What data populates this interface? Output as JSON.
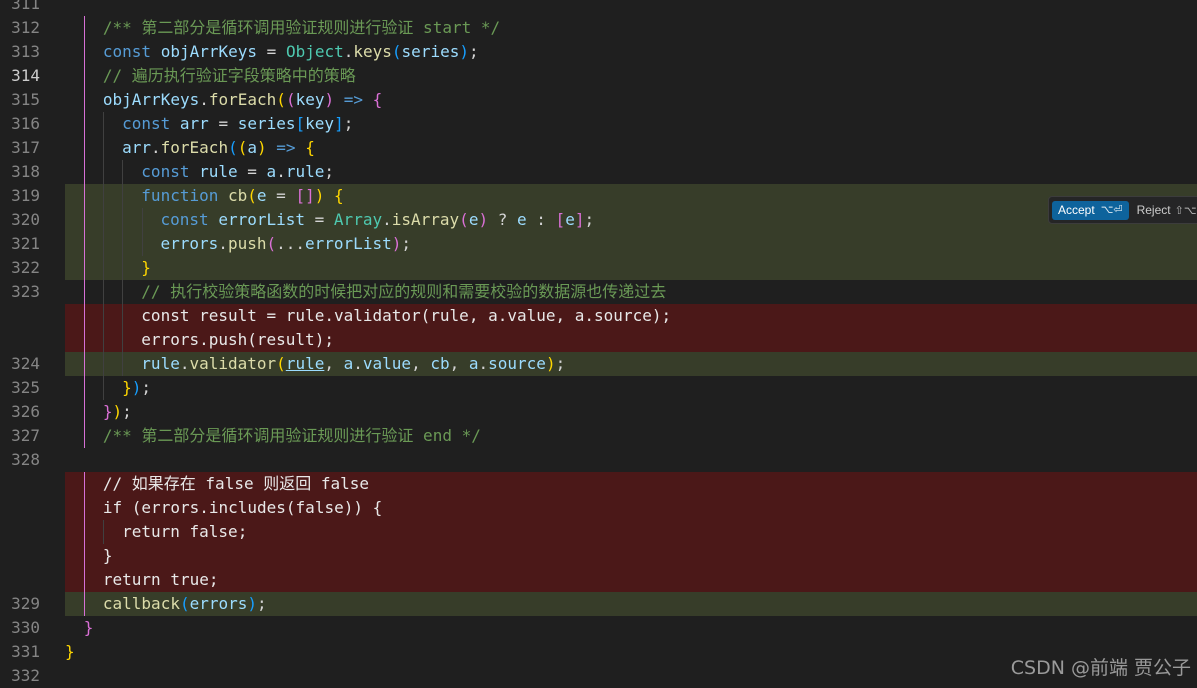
{
  "editor": {
    "rows": [
      {
        "ln": "311",
        "kind": "normal",
        "indent": 0,
        "tokens": []
      },
      {
        "ln": "312",
        "kind": "normal",
        "indent": 2,
        "tokens": [
          [
            "/** 第二部分是循环调用验证规则进行验证 start */",
            "cm"
          ]
        ]
      },
      {
        "ln": "313",
        "kind": "normal",
        "indent": 2,
        "tokens": [
          [
            "const",
            "kw"
          ],
          [
            " ",
            "pl"
          ],
          [
            "objArrKeys",
            "var"
          ],
          [
            " = ",
            "pl"
          ],
          [
            "Object",
            "cls"
          ],
          [
            ".",
            "pl"
          ],
          [
            "keys",
            "fn"
          ],
          [
            "(",
            "b3"
          ],
          [
            "series",
            "var"
          ],
          [
            ")",
            "b3"
          ],
          [
            ";",
            "pl"
          ]
        ]
      },
      {
        "ln": "314",
        "kind": "normal",
        "indent": 2,
        "active": true,
        "tokens": [
          [
            "// 遍历执行验证字段策略中的策略",
            "cm"
          ]
        ]
      },
      {
        "ln": "315",
        "kind": "normal",
        "indent": 2,
        "tokens": [
          [
            "objArrKeys",
            "var"
          ],
          [
            ".",
            "pl"
          ],
          [
            "forEach",
            "fn"
          ],
          [
            "(",
            "b1"
          ],
          [
            "(",
            "b2"
          ],
          [
            "key",
            "var"
          ],
          [
            ")",
            "b2"
          ],
          [
            " ",
            "pl"
          ],
          [
            "=>",
            "kw"
          ],
          [
            " ",
            "pl"
          ],
          [
            "{",
            "b2"
          ]
        ]
      },
      {
        "ln": "316",
        "kind": "normal",
        "indent": 3,
        "tokens": [
          [
            "const",
            "kw"
          ],
          [
            " ",
            "pl"
          ],
          [
            "arr",
            "var"
          ],
          [
            " = ",
            "pl"
          ],
          [
            "series",
            "var"
          ],
          [
            "[",
            "b3"
          ],
          [
            "key",
            "var"
          ],
          [
            "]",
            "b3"
          ],
          [
            ";",
            "pl"
          ]
        ]
      },
      {
        "ln": "317",
        "kind": "normal",
        "indent": 3,
        "tokens": [
          [
            "arr",
            "var"
          ],
          [
            ".",
            "pl"
          ],
          [
            "forEach",
            "fn"
          ],
          [
            "(",
            "b3"
          ],
          [
            "(",
            "b1"
          ],
          [
            "a",
            "var"
          ],
          [
            ")",
            "b1"
          ],
          [
            " ",
            "pl"
          ],
          [
            "=>",
            "kw"
          ],
          [
            " ",
            "pl"
          ],
          [
            "{",
            "b1"
          ]
        ]
      },
      {
        "ln": "318",
        "kind": "normal",
        "indent": 4,
        "tokens": [
          [
            "const",
            "kw"
          ],
          [
            " ",
            "pl"
          ],
          [
            "rule",
            "var"
          ],
          [
            " = ",
            "pl"
          ],
          [
            "a",
            "var"
          ],
          [
            ".",
            "pl"
          ],
          [
            "rule",
            "var"
          ],
          [
            ";",
            "pl"
          ]
        ]
      },
      {
        "ln": "319",
        "kind": "ins",
        "indent": 4,
        "tokens": [
          [
            "function",
            "kw"
          ],
          [
            " ",
            "pl"
          ],
          [
            "cb",
            "fn"
          ],
          [
            "(",
            "b1"
          ],
          [
            "e",
            "var"
          ],
          [
            " = ",
            "pl"
          ],
          [
            "[]",
            "b2"
          ],
          [
            ")",
            "b1"
          ],
          [
            " ",
            "pl"
          ],
          [
            "{",
            "b1"
          ]
        ]
      },
      {
        "ln": "320",
        "kind": "ins",
        "indent": 5,
        "tokens": [
          [
            "const",
            "kw"
          ],
          [
            " ",
            "pl"
          ],
          [
            "errorList",
            "var"
          ],
          [
            " = ",
            "pl"
          ],
          [
            "Array",
            "cls"
          ],
          [
            ".",
            "pl"
          ],
          [
            "isArray",
            "fn"
          ],
          [
            "(",
            "b2"
          ],
          [
            "e",
            "var"
          ],
          [
            ")",
            "b2"
          ],
          [
            " ? ",
            "pl"
          ],
          [
            "e",
            "var"
          ],
          [
            " : ",
            "pl"
          ],
          [
            "[",
            "b2"
          ],
          [
            "e",
            "var"
          ],
          [
            "]",
            "b2"
          ],
          [
            ";",
            "pl"
          ]
        ]
      },
      {
        "ln": "321",
        "kind": "ins",
        "indent": 5,
        "tokens": [
          [
            "errors",
            "var"
          ],
          [
            ".",
            "pl"
          ],
          [
            "push",
            "fn"
          ],
          [
            "(",
            "b2"
          ],
          [
            "...",
            "pl"
          ],
          [
            "errorList",
            "var"
          ],
          [
            ")",
            "b2"
          ],
          [
            ";",
            "pl"
          ]
        ]
      },
      {
        "ln": "322",
        "kind": "ins",
        "indent": 4,
        "tokens": [
          [
            "}",
            "b1"
          ]
        ]
      },
      {
        "ln": "323",
        "kind": "normal",
        "indent": 4,
        "tokens": [
          [
            "// 执行校验策略函数的时候把对应的规则和需要校验的数据源也传递过去",
            "cm"
          ]
        ]
      },
      {
        "ln": "",
        "kind": "del",
        "indent": 4,
        "tokens": [
          [
            "const result = rule.validator(rule, a.value, a.source);",
            "pl"
          ]
        ]
      },
      {
        "ln": "",
        "kind": "del",
        "indent": 4,
        "tokens": [
          [
            "errors.push(result);",
            "pl"
          ]
        ]
      },
      {
        "ln": "324",
        "kind": "ins",
        "indent": 4,
        "tokens": [
          [
            "rule",
            "var"
          ],
          [
            ".",
            "pl"
          ],
          [
            "validator",
            "fn"
          ],
          [
            "(",
            "b1"
          ],
          [
            "rule",
            "var ul"
          ],
          [
            ", ",
            "pl"
          ],
          [
            "a",
            "var"
          ],
          [
            ".",
            "pl"
          ],
          [
            "value",
            "var"
          ],
          [
            ", ",
            "pl"
          ],
          [
            "cb",
            "var"
          ],
          [
            ", ",
            "pl"
          ],
          [
            "a",
            "var"
          ],
          [
            ".",
            "pl"
          ],
          [
            "source",
            "var"
          ],
          [
            ")",
            "b1"
          ],
          [
            ";",
            "pl"
          ]
        ]
      },
      {
        "ln": "325",
        "kind": "normal",
        "indent": 3,
        "tokens": [
          [
            "}",
            "b1"
          ],
          [
            ")",
            "b3"
          ],
          [
            ";",
            "pl"
          ]
        ]
      },
      {
        "ln": "326",
        "kind": "normal",
        "indent": 2,
        "tokens": [
          [
            "}",
            "b2"
          ],
          [
            ")",
            "b1"
          ],
          [
            ";",
            "pl"
          ]
        ]
      },
      {
        "ln": "327",
        "kind": "normal",
        "indent": 2,
        "tokens": [
          [
            "/** 第二部分是循环调用验证规则进行验证 end */",
            "cm"
          ]
        ]
      },
      {
        "ln": "328",
        "kind": "normal",
        "indent": 0,
        "tokens": []
      },
      {
        "ln": "",
        "kind": "del",
        "indent": 2,
        "tokens": [
          [
            "// 如果存在 false 则返回 false",
            "pl"
          ]
        ]
      },
      {
        "ln": "",
        "kind": "del",
        "indent": 2,
        "tokens": [
          [
            "if (errors.includes(false)) {",
            "pl"
          ]
        ]
      },
      {
        "ln": "",
        "kind": "del",
        "indent": 3,
        "tokens": [
          [
            "return false;",
            "pl"
          ]
        ]
      },
      {
        "ln": "",
        "kind": "del",
        "indent": 2,
        "tokens": [
          [
            "}",
            "pl"
          ]
        ]
      },
      {
        "ln": "",
        "kind": "del",
        "indent": 2,
        "tokens": [
          [
            "return true;",
            "pl"
          ]
        ]
      },
      {
        "ln": "329",
        "kind": "ins",
        "indent": 2,
        "tokens": [
          [
            "callback",
            "fn"
          ],
          [
            "(",
            "b3"
          ],
          [
            "errors",
            "var"
          ],
          [
            ")",
            "b3"
          ],
          [
            ";",
            "pl"
          ]
        ]
      },
      {
        "ln": "330",
        "kind": "normal",
        "indent": 1,
        "tokens": [
          [
            "}",
            "b2"
          ]
        ]
      },
      {
        "ln": "331",
        "kind": "normal",
        "indent": 0,
        "tokens": [
          [
            "}",
            "b1"
          ]
        ]
      },
      {
        "ln": "332",
        "kind": "normal",
        "indent": 0,
        "tokens": []
      }
    ]
  },
  "diff_actions": {
    "accept_label": "Accept",
    "accept_shortcut": "⌥⏎",
    "reject_label": "Reject",
    "reject_shortcut": "⇧⌥"
  },
  "watermark": "CSDN @前端 贾公子",
  "colors": {
    "background": "#1f1f1f",
    "inserted_line": "#373d29",
    "deleted_line": "#4b1818",
    "accept_button": "#0e639c"
  }
}
